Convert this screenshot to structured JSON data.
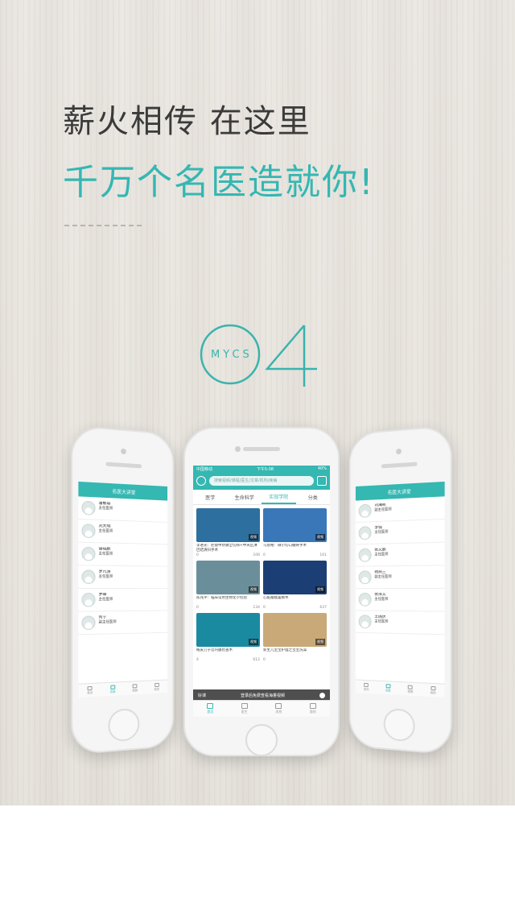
{
  "headline": {
    "line1": "薪火相传 在这里",
    "line2": "千万个名医造就你!"
  },
  "logo": {
    "text": "MYCS",
    "number": "4"
  },
  "colors": {
    "accent": "#35b7b2",
    "text_dark": "#3b3b3b"
  },
  "center_phone": {
    "status": {
      "carrier": "中国移动",
      "time": "下午5:08",
      "battery": "40%"
    },
    "search_placeholder": "搜索视频/课程/医生/文章/机构/疾病",
    "tabs": [
      "医学",
      "生命科学",
      "实效学院",
      "分类"
    ],
    "active_tab": 2,
    "videos": [
      {
        "caption": "李进光：腔镜甲状腺全切除+中央区淋巴结清扫手术",
        "likes": "0",
        "views": "106",
        "badge": "视频",
        "thumb": "#2d6f9f"
      },
      {
        "caption": "乌恩格：微小切口髓骨手术",
        "likes": "0",
        "views": "161",
        "badge": "视频",
        "thumb": "#3a77b8"
      },
      {
        "caption": "陈兆平：临床常用生物化学检验",
        "likes": "0",
        "views": "134",
        "badge": "视频",
        "thumb": "#6b8f9a"
      },
      {
        "caption": "心脏瓣膜置换术",
        "likes": "0",
        "views": "637",
        "badge": "视频",
        "thumb": "#1b3f74"
      },
      {
        "caption": "植皮刀子宫内膜检查术",
        "likes": "4",
        "views": "612",
        "badge": "视频",
        "thumb": "#1a8aa1"
      },
      {
        "caption": "新生儿宝宝护理之宝宝洗澡",
        "likes": "0",
        "views": "",
        "badge": "视频",
        "thumb": "#c9a978"
      }
    ],
    "promo": {
      "left": "好课",
      "text": "登录后免费查看海量视频"
    },
    "nav": [
      "首页",
      "医生",
      "消息",
      "我的"
    ]
  },
  "left_phone": {
    "title": "名医大讲堂",
    "doctors": [
      {
        "name": "温敏瑜",
        "title": "主任医师"
      },
      {
        "name": "刘大明",
        "title": "主任医师"
      },
      {
        "name": "谢晓鹏",
        "title": "主任医师"
      },
      {
        "name": "罗凡涛",
        "title": "主任医师"
      },
      {
        "name": "罗峰",
        "title": "主任医师"
      },
      {
        "name": "何宁",
        "title": "副主任医师"
      }
    ],
    "nav": [
      "首页",
      "名医",
      "视频",
      "我的"
    ]
  },
  "right_phone": {
    "title": "名医大讲堂",
    "doctors": [
      {
        "name": "刘海彬",
        "title": "副主任医师"
      },
      {
        "name": "李强",
        "title": "主任医师"
      },
      {
        "name": "张文鹏",
        "title": "主任医师"
      },
      {
        "name": "杨燕兰",
        "title": "副主任医师"
      },
      {
        "name": "张泽文",
        "title": "主任医师"
      },
      {
        "name": "王国庆",
        "title": "主任医师"
      }
    ],
    "nav": [
      "首页",
      "名医",
      "视频",
      "我的"
    ]
  }
}
